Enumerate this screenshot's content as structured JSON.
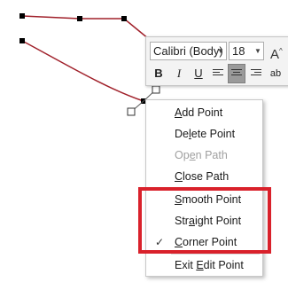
{
  "colors": {
    "path_line": "#a0202a",
    "highlight_box": "#d9212b",
    "vertex_fill": "#000000"
  },
  "mini_toolbar": {
    "font_name": "Calibri (Body)",
    "font_size": "18",
    "grow_font_label": "A",
    "bold_label": "B",
    "italic_label": "I",
    "underline_label": "U",
    "highlight_label": "ab",
    "icons": [
      "dropdown-arrow-icon",
      "grow-font-icon",
      "align-left-icon",
      "align-center-icon",
      "align-right-icon",
      "highlight-icon"
    ]
  },
  "context_menu": {
    "items": [
      {
        "label": "Add Point",
        "underline": "A",
        "rest": "dd Point",
        "enabled": true
      },
      {
        "label": "Delete Point",
        "underline_before": "De",
        "underline": "l",
        "rest": "ete Point",
        "enabled": true
      },
      {
        "label": "Open Path",
        "underline_before": "Op",
        "underline": "e",
        "rest": "n Path",
        "enabled": false
      },
      {
        "label": "Close Path",
        "underline": "C",
        "rest": "lose Path",
        "enabled": true
      },
      {
        "label": "Smooth Point",
        "underline": "S",
        "rest": "mooth Point",
        "enabled": true
      },
      {
        "label": "Straight Point",
        "underline_before": "Str",
        "underline": "a",
        "rest": "ight Point",
        "enabled": true
      },
      {
        "label": "Corner Point",
        "underline": "C",
        "rest": "orner Point",
        "enabled": true,
        "checked": true
      },
      {
        "label": "Exit Edit Point",
        "underline_before": "Exit ",
        "underline": "E",
        "rest": "dit Point",
        "enabled": true
      }
    ],
    "check_glyph": "✓"
  }
}
